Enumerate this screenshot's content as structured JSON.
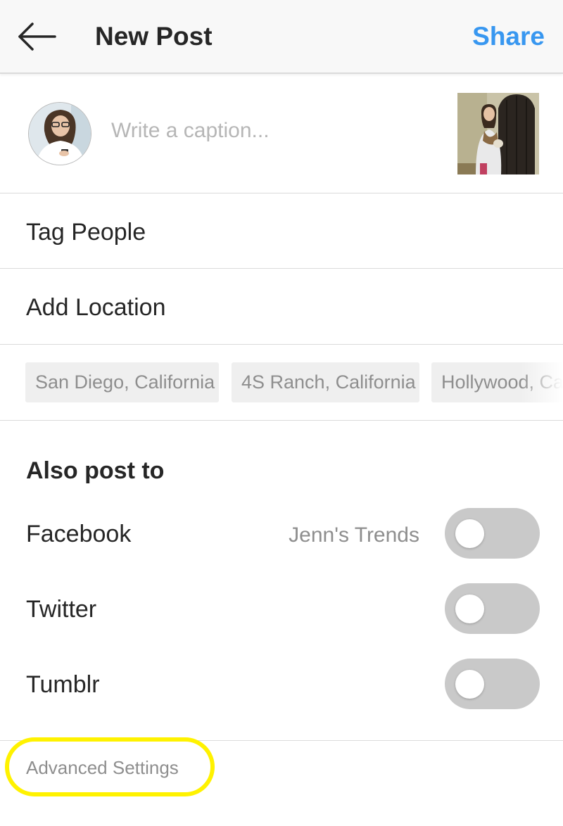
{
  "header": {
    "back_icon": "arrow-left-icon",
    "title": "New Post",
    "share_label": "Share",
    "accent_color": "#3897f0"
  },
  "caption": {
    "placeholder": "Write a caption...",
    "value": ""
  },
  "menu": {
    "tag_people": "Tag People",
    "add_location": "Add Location"
  },
  "location_suggestions": [
    "San Diego, California",
    "4S Ranch, California",
    "Hollywood, California"
  ],
  "also_post_to": {
    "title": "Also post to",
    "facebook": {
      "label": "Facebook",
      "account": "Jenn's Trends",
      "enabled": false
    },
    "twitter": {
      "label": "Twitter",
      "enabled": false
    },
    "tumblr": {
      "label": "Tumblr",
      "enabled": false
    }
  },
  "advanced_settings": "Advanced Settings",
  "highlight_color": "#fff200"
}
